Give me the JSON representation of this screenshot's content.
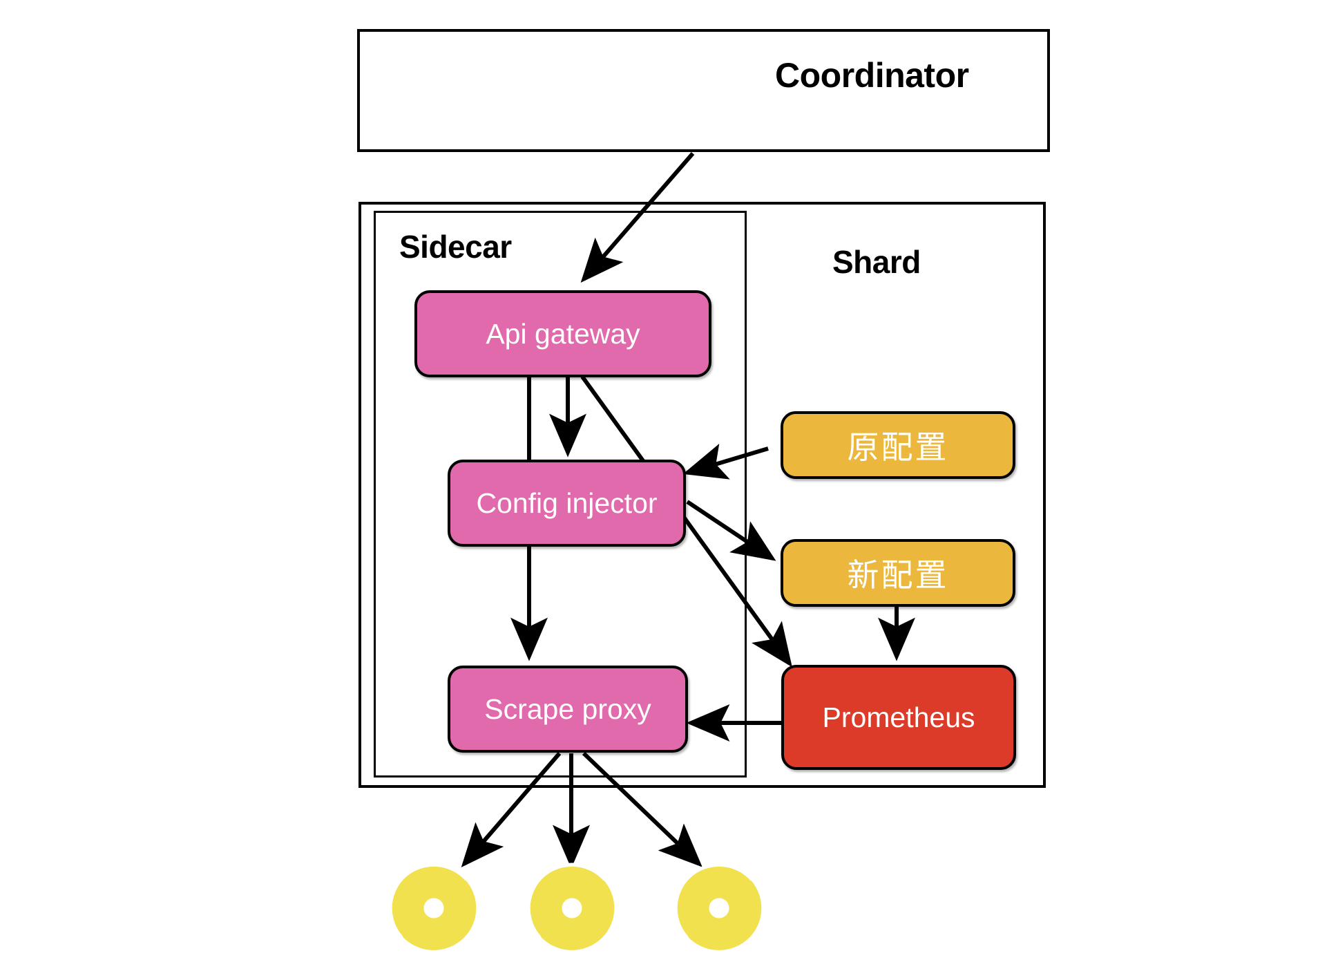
{
  "diagram": {
    "title_label": "Coordinator",
    "containers": [
      {
        "id": "coordinator",
        "label": "Coordinator"
      },
      {
        "id": "shard",
        "label": "Shard"
      },
      {
        "id": "sidecar",
        "label": "Sidecar"
      }
    ],
    "nodes": [
      {
        "id": "api-gateway",
        "label": "Api gateway",
        "color": "#e06aab"
      },
      {
        "id": "config-injector",
        "label": "Config injector",
        "color": "#e06aab"
      },
      {
        "id": "scrape-proxy",
        "label": "Scrape proxy",
        "color": "#e06aab"
      },
      {
        "id": "old-config",
        "label": "原配置",
        "color": "#ebb83d"
      },
      {
        "id": "new-config",
        "label": "新配置",
        "color": "#ebb83d"
      },
      {
        "id": "prometheus",
        "label": "Prometheus",
        "color": "#db3b28"
      }
    ],
    "targets": [
      {
        "id": "target-1",
        "icon": "aperture-icon",
        "color": "#f2e14e"
      },
      {
        "id": "target-2",
        "icon": "aperture-icon",
        "color": "#f2e14e"
      },
      {
        "id": "target-3",
        "icon": "aperture-icon",
        "color": "#f2e14e"
      }
    ],
    "edges": [
      {
        "from": "coordinator",
        "to": "api-gateway"
      },
      {
        "from": "api-gateway",
        "to": "config-injector"
      },
      {
        "from": "api-gateway",
        "to": "scrape-proxy"
      },
      {
        "from": "api-gateway",
        "to": "prometheus"
      },
      {
        "from": "old-config",
        "to": "config-injector"
      },
      {
        "from": "config-injector",
        "to": "new-config"
      },
      {
        "from": "new-config",
        "to": "prometheus"
      },
      {
        "from": "prometheus",
        "to": "scrape-proxy"
      },
      {
        "from": "scrape-proxy",
        "to": "target-1"
      },
      {
        "from": "scrape-proxy",
        "to": "target-2"
      },
      {
        "from": "scrape-proxy",
        "to": "target-3"
      }
    ],
    "colors": {
      "pink": "#e06aab",
      "amber": "#ebb83d",
      "red": "#db3b28",
      "yellow": "#f2e14e",
      "stroke": "#000000",
      "background": "#ffffff"
    }
  }
}
